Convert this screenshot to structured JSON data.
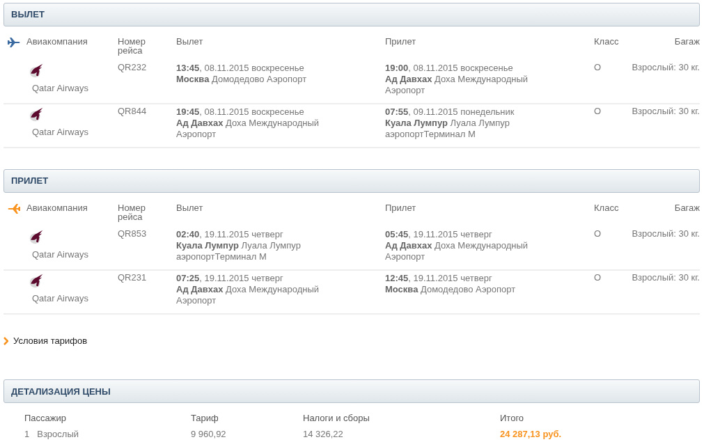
{
  "sections": [
    {
      "title": "ВЫЛЕТ",
      "kind": "outbound",
      "columns": [
        "Авиакомпания",
        "Номер рейса",
        "Вылет",
        "Прилет",
        "Класс",
        "Багаж"
      ],
      "rows": [
        {
          "airline": "Qatar Airways",
          "flight": "QR232",
          "departure": [
            "**13:45**, 08.11.2015 воскресенье",
            "**Москва** Домодедово Аэропорт"
          ],
          "arrival": [
            "**19:00**, 08.11.2015 воскресенье",
            "**Ад Давхах** Доха Международный Аэропорт"
          ],
          "class": "O",
          "baggage": "Взрослый: 30 кг."
        },
        {
          "airline": "Qatar Airways",
          "flight": "QR844",
          "departure": [
            "**19:45**, 08.11.2015 воскресенье",
            "**Ад Давхах** Доха Международный Аэропорт"
          ],
          "arrival": [
            "**07:55**, 09.11.2015 понедельник",
            "**Куала Лумпур** Луала Лумпур аэропортТерминал  M"
          ],
          "class": "O",
          "baggage": "Взрослый: 30 кг."
        }
      ]
    },
    {
      "title": "ПРИЛЕТ",
      "kind": "return",
      "columns": [
        "Авиакомпания",
        "Номер рейса",
        "Вылет",
        "Прилет",
        "Класс",
        "Багаж"
      ],
      "rows": [
        {
          "airline": "Qatar Airways",
          "flight": "QR853",
          "departure": [
            "**02:40**, 19.11.2015 четверг",
            "**Куала Лумпур** Луала Лумпур аэропортТерминал  M"
          ],
          "arrival": [
            "**05:45**, 19.11.2015 четверг",
            "**Ад Давхах** Доха Международный Аэропорт"
          ],
          "class": "O",
          "baggage": "Взрослый: 30 кг."
        },
        {
          "airline": "Qatar Airways",
          "flight": "QR231",
          "departure": [
            "**07:25**, 19.11.2015 четверг",
            "**Ад Давхах** Доха Международный Аэропорт"
          ],
          "arrival": [
            "**12:45**, 19.11.2015 четверг",
            "**Москва** Домодедово Аэропорт"
          ],
          "class": "O",
          "baggage": "Взрослый: 30 кг."
        }
      ]
    }
  ],
  "fare_rules_link": "Условия тарифов",
  "price": {
    "title": "ДЕТАЛИЗАЦИЯ ЦЕНЫ",
    "columns": [
      "Пассажир",
      "Тариф",
      "Налоги и сборы",
      "Итого"
    ],
    "rows": [
      {
        "number": "1",
        "passenger": "Взрослый",
        "fare": "9 960,92",
        "taxes": "14 326,22",
        "total": "24 287,13 руб."
      }
    ]
  }
}
